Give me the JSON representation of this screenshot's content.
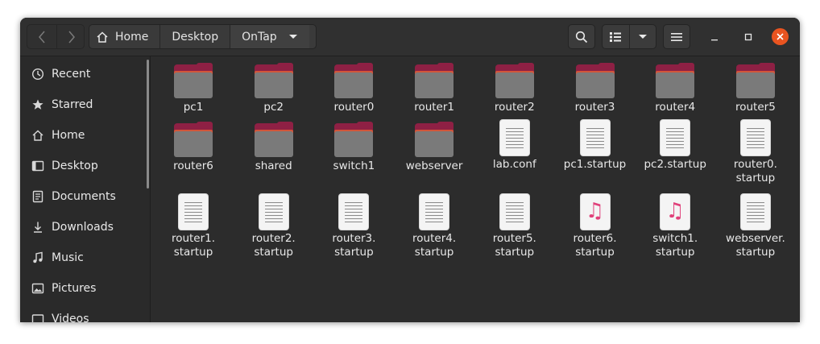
{
  "window": {
    "title": "OnTap"
  },
  "breadcrumbs": [
    "Home",
    "Desktop",
    "OnTap"
  ],
  "toolbar": {
    "back_icon": "chevron-left-icon",
    "forward_icon": "chevron-right-icon",
    "search_icon": "search-icon",
    "view_icon": "list-view-icon",
    "view_menu_icon": "chevron-down-icon",
    "menu_icon": "hamburger-menu-icon",
    "minimize_icon": "minimize-icon",
    "maximize_icon": "maximize-icon",
    "close_icon": "close-icon",
    "close_color": "#e95420"
  },
  "sidebar": {
    "items": [
      {
        "label": "Recent",
        "icon": "clock-icon"
      },
      {
        "label": "Starred",
        "icon": "star-icon"
      },
      {
        "label": "Home",
        "icon": "home-icon"
      },
      {
        "label": "Desktop",
        "icon": "desktop-icon"
      },
      {
        "label": "Documents",
        "icon": "documents-icon"
      },
      {
        "label": "Downloads",
        "icon": "download-icon"
      },
      {
        "label": "Music",
        "icon": "music-icon"
      },
      {
        "label": "Pictures",
        "icon": "pictures-icon"
      },
      {
        "label": "Videos",
        "icon": "videos-icon"
      }
    ]
  },
  "files": [
    {
      "name": "pc1",
      "type": "folder"
    },
    {
      "name": "pc2",
      "type": "folder"
    },
    {
      "name": "router0",
      "type": "folder"
    },
    {
      "name": "router1",
      "type": "folder"
    },
    {
      "name": "router2",
      "type": "folder"
    },
    {
      "name": "router3",
      "type": "folder"
    },
    {
      "name": "router4",
      "type": "folder"
    },
    {
      "name": "router5",
      "type": "folder"
    },
    {
      "name": "router6",
      "type": "folder"
    },
    {
      "name": "shared",
      "type": "folder"
    },
    {
      "name": "switch1",
      "type": "folder"
    },
    {
      "name": "webserver",
      "type": "folder"
    },
    {
      "name": "lab.conf",
      "type": "text"
    },
    {
      "name": "pc1.startup",
      "type": "text"
    },
    {
      "name": "pc2.startup",
      "type": "text"
    },
    {
      "name": "router0.\nstartup",
      "type": "text"
    },
    {
      "name": "router1.\nstartup",
      "type": "text"
    },
    {
      "name": "router2.\nstartup",
      "type": "text"
    },
    {
      "name": "router3.\nstartup",
      "type": "text"
    },
    {
      "name": "router4.\nstartup",
      "type": "text"
    },
    {
      "name": "router5.\nstartup",
      "type": "text"
    },
    {
      "name": "router6.\nstartup",
      "type": "audio"
    },
    {
      "name": "switch1.\nstartup",
      "type": "audio"
    },
    {
      "name": "webserver.\nstartup",
      "type": "text"
    }
  ]
}
